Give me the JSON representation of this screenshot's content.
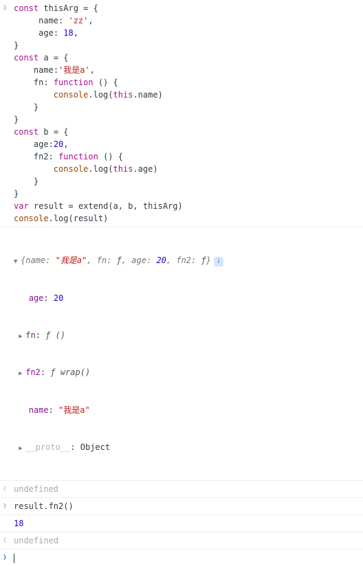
{
  "code_block": "const thisArg = {\n     name: 'zz',\n     age: 18,\n}\nconst a = {\n    name:'我是a',\n    fn: function () {\n        console.log(this.name)\n    }\n}\nconst b = {\n    age:20,\n    fn2: function () {\n        console.log(this.age)\n    }\n}\nvar result = extend(a, b, thisArg)\nconsole.log(result)",
  "object_preview": {
    "summary": "{name: \"我是a\", fn: ƒ, age: 20, fn2: ƒ}",
    "props": {
      "age_key": "age",
      "age_val": "20",
      "fn_key": "fn",
      "fn_val": "ƒ ()",
      "fn2_key": "fn2",
      "fn2_val": "ƒ wrap()",
      "name_key": "name",
      "name_val": "\"我是a\"",
      "proto_key": "__proto__",
      "proto_val": "Object"
    }
  },
  "undefined1": "undefined",
  "input2": "result.fn2()",
  "output2": "18",
  "undefined2": "undefined",
  "prompt_empty": " ",
  "tokens": {
    "const": "const",
    "var": "var",
    "function": "function",
    "this": "this",
    "thisArg": "thisArg",
    "a": "a",
    "b": "b",
    "result": "result",
    "extend": "extend",
    "console": "console",
    "log": "log",
    "name": "name",
    "age": "age",
    "fn": "fn",
    "fn2": "fn2",
    "zz": "'zz'",
    "woshia": "'我是a'",
    "n18": "18",
    "n20": "20"
  }
}
